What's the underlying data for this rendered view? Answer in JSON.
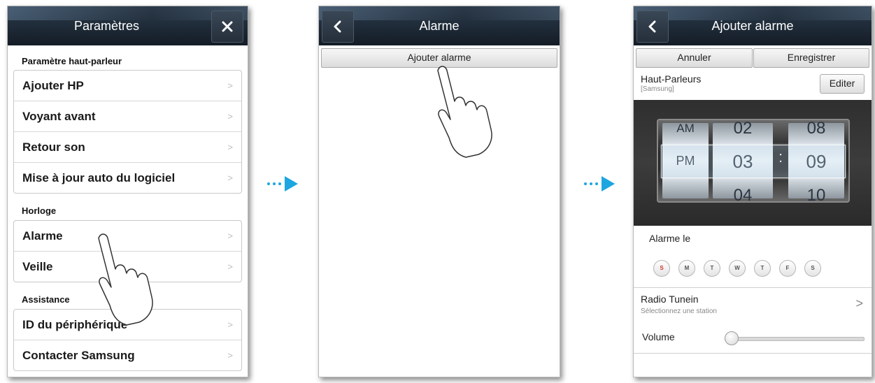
{
  "panel1": {
    "title": "Paramètres",
    "sections": [
      {
        "label": "Paramètre haut-parleur",
        "items": [
          "Ajouter HP",
          "Voyant avant",
          "Retour son",
          "Mise à jour auto du logiciel"
        ]
      },
      {
        "label": "Horloge",
        "items": [
          "Alarme",
          "Veille"
        ]
      },
      {
        "label": "Assistance",
        "items": [
          "ID du périphérique",
          "Contacter Samsung"
        ]
      }
    ]
  },
  "panel2": {
    "title": "Alarme",
    "add_button": "Ajouter alarme"
  },
  "panel3": {
    "title": "Ajouter alarme",
    "cancel": "Annuler",
    "save": "Enregistrer",
    "speakers_title": "Haut-Parleurs",
    "speakers_sub": "[Samsung]",
    "edit": "Editer",
    "picker": {
      "ampm": {
        "prev": "AM",
        "current": "PM"
      },
      "hour": {
        "prev": "02",
        "current": "03",
        "next": "04"
      },
      "separator": ":",
      "minute": {
        "prev": "08",
        "current": "09",
        "next": "10"
      }
    },
    "alarm_label": "Alarme le",
    "days": [
      "S",
      "M",
      "T",
      "W",
      "T",
      "F",
      "S"
    ],
    "radio_title": "Radio Tunein",
    "radio_sub": "Sélectionnez une station",
    "volume_label": "Volume",
    "volume_level": 0
  },
  "colors": {
    "arrow": "#1ea6e0",
    "bar_dark": "#1e2a37",
    "sunday_red": "#d0342c"
  }
}
